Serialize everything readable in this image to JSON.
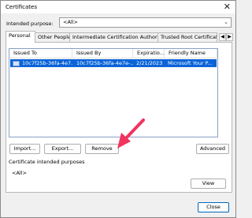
{
  "window": {
    "title": "Certificates",
    "close_glyph": "✕"
  },
  "purpose": {
    "label": "Intended purpose:",
    "value": "<All>",
    "chevron_icon": "chevron-down-icon"
  },
  "tabs": [
    {
      "label": "Personal"
    },
    {
      "label": "Other People"
    },
    {
      "label": "Intermediate Certification Authorities"
    },
    {
      "label": "Trusted Root Certification"
    }
  ],
  "tab_scroll": {
    "left": "◀",
    "right": "▶"
  },
  "list": {
    "columns": [
      "Issued To",
      "Issued By",
      "Expiratio...",
      "Friendly Name"
    ],
    "rows": [
      {
        "issued_to": "10c7f25b-36fa-4e7...",
        "issued_by": "10c7f25b-36fa-4e7e-...",
        "expiration": "2/21/2023",
        "friendly_name": "Microsoft Your P..."
      }
    ]
  },
  "buttons": {
    "import": "Import...",
    "export": "Export...",
    "remove": "Remove",
    "advanced": "Advanced",
    "view": "View",
    "close": "Close"
  },
  "purposes_group": {
    "title": "Certificate intended purposes",
    "value": "<All>"
  },
  "colors": {
    "selection": "#0a64d8",
    "annotation_arrow": "#f0345e"
  }
}
